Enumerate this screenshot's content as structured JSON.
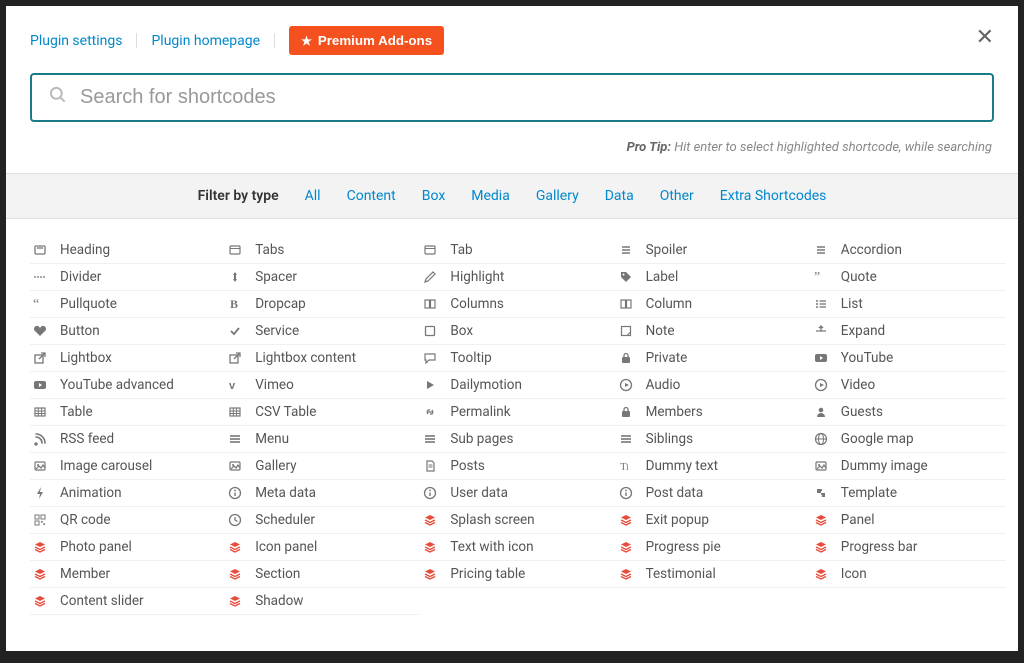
{
  "topbar": {
    "links": {
      "settings": "Plugin settings",
      "homepage": "Plugin homepage"
    },
    "premium_button": "Premium Add-ons"
  },
  "search": {
    "placeholder": "Search for shortcodes"
  },
  "pro_tip": {
    "label": "Pro Tip:",
    "text": "Hit enter to select highlighted shortcode, while searching"
  },
  "filter": {
    "label": "Filter by type",
    "items": [
      "All",
      "Content",
      "Box",
      "Media",
      "Gallery",
      "Data",
      "Other",
      "Extra Shortcodes"
    ]
  },
  "columns": [
    [
      {
        "label": "Heading",
        "icon": "heading",
        "red": false
      },
      {
        "label": "Divider",
        "icon": "divider",
        "red": false
      },
      {
        "label": "Pullquote",
        "icon": "quote-l",
        "red": false
      },
      {
        "label": "Button",
        "icon": "heart",
        "red": false
      },
      {
        "label": "Lightbox",
        "icon": "external",
        "red": false
      },
      {
        "label": "YouTube advanced",
        "icon": "youtube",
        "red": false
      },
      {
        "label": "Table",
        "icon": "table",
        "red": false
      },
      {
        "label": "RSS feed",
        "icon": "rss",
        "red": false
      },
      {
        "label": "Image carousel",
        "icon": "image",
        "red": false
      },
      {
        "label": "Animation",
        "icon": "bolt",
        "red": false
      },
      {
        "label": "QR code",
        "icon": "qr",
        "red": false
      },
      {
        "label": "Photo panel",
        "icon": "stack",
        "red": true
      },
      {
        "label": "Member",
        "icon": "stack",
        "red": true
      },
      {
        "label": "Content slider",
        "icon": "stack",
        "red": true
      }
    ],
    [
      {
        "label": "Tabs",
        "icon": "window",
        "red": false
      },
      {
        "label": "Spacer",
        "icon": "arrows-v",
        "red": false
      },
      {
        "label": "Dropcap",
        "icon": "bold",
        "red": false
      },
      {
        "label": "Service",
        "icon": "check",
        "red": false
      },
      {
        "label": "Lightbox content",
        "icon": "external",
        "red": false
      },
      {
        "label": "Vimeo",
        "icon": "vimeo",
        "red": false
      },
      {
        "label": "CSV Table",
        "icon": "table",
        "red": false
      },
      {
        "label": "Menu",
        "icon": "menu",
        "red": false
      },
      {
        "label": "Gallery",
        "icon": "image",
        "red": false
      },
      {
        "label": "Meta data",
        "icon": "info",
        "red": false
      },
      {
        "label": "Scheduler",
        "icon": "clock",
        "red": false
      },
      {
        "label": "Icon panel",
        "icon": "stack",
        "red": true
      },
      {
        "label": "Section",
        "icon": "stack",
        "red": true
      },
      {
        "label": "Shadow",
        "icon": "stack",
        "red": true
      }
    ],
    [
      {
        "label": "Tab",
        "icon": "window",
        "red": false
      },
      {
        "label": "Highlight",
        "icon": "pencil",
        "red": false
      },
      {
        "label": "Columns",
        "icon": "columns",
        "red": false
      },
      {
        "label": "Box",
        "icon": "box",
        "red": false
      },
      {
        "label": "Tooltip",
        "icon": "chat",
        "red": false
      },
      {
        "label": "Dailymotion",
        "icon": "play",
        "red": false
      },
      {
        "label": "Permalink",
        "icon": "link",
        "red": false
      },
      {
        "label": "Sub pages",
        "icon": "menu",
        "red": false
      },
      {
        "label": "Posts",
        "icon": "doc",
        "red": false
      },
      {
        "label": "User data",
        "icon": "info",
        "red": false
      },
      {
        "label": "Splash screen",
        "icon": "stack",
        "red": true
      },
      {
        "label": "Text with icon",
        "icon": "stack",
        "red": true
      },
      {
        "label": "Pricing table",
        "icon": "stack",
        "red": true
      }
    ],
    [
      {
        "label": "Spoiler",
        "icon": "list",
        "red": false
      },
      {
        "label": "Label",
        "icon": "tag",
        "red": false
      },
      {
        "label": "Column",
        "icon": "columns",
        "red": false
      },
      {
        "label": "Note",
        "icon": "note",
        "red": false
      },
      {
        "label": "Private",
        "icon": "lock",
        "red": false
      },
      {
        "label": "Audio",
        "icon": "play-c",
        "red": false
      },
      {
        "label": "Members",
        "icon": "lock",
        "red": false
      },
      {
        "label": "Siblings",
        "icon": "menu",
        "red": false
      },
      {
        "label": "Dummy text",
        "icon": "text",
        "red": false
      },
      {
        "label": "Post data",
        "icon": "info",
        "red": false
      },
      {
        "label": "Exit popup",
        "icon": "stack",
        "red": true
      },
      {
        "label": "Progress pie",
        "icon": "stack",
        "red": true
      },
      {
        "label": "Testimonial",
        "icon": "stack",
        "red": true
      }
    ],
    [
      {
        "label": "Accordion",
        "icon": "list",
        "red": false
      },
      {
        "label": "Quote",
        "icon": "quote-r",
        "red": false
      },
      {
        "label": "List",
        "icon": "list2",
        "red": false
      },
      {
        "label": "Expand",
        "icon": "expand",
        "red": false
      },
      {
        "label": "YouTube",
        "icon": "youtube",
        "red": false
      },
      {
        "label": "Video",
        "icon": "play-c",
        "red": false
      },
      {
        "label": "Guests",
        "icon": "user",
        "red": false
      },
      {
        "label": "Google map",
        "icon": "globe",
        "red": false
      },
      {
        "label": "Dummy image",
        "icon": "image",
        "red": false
      },
      {
        "label": "Template",
        "icon": "puzzle",
        "red": false
      },
      {
        "label": "Panel",
        "icon": "stack",
        "red": true
      },
      {
        "label": "Progress bar",
        "icon": "stack",
        "red": true
      },
      {
        "label": "Icon",
        "icon": "stack",
        "red": true
      }
    ]
  ]
}
